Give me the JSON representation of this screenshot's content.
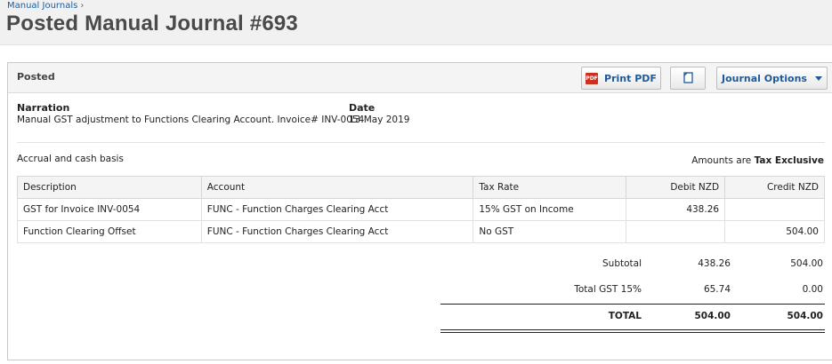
{
  "breadcrumb": {
    "parent": "Manual Journals",
    "separator": "›"
  },
  "page": {
    "title": "Posted Manual Journal #693"
  },
  "panel": {
    "status": "Posted",
    "buttons": {
      "print_pdf": "Print PDF",
      "copy_icon": "copy-icon",
      "journal_options": "Journal Options"
    }
  },
  "details": {
    "narration_label": "Narration",
    "narration_value": "Manual GST adjustment to Functions Clearing Account. Invoice# INV-0054",
    "date_label": "Date",
    "date_value": "13 May 2019"
  },
  "basis": "Accrual and cash basis",
  "amounts": {
    "prefix": "Amounts are",
    "mode": "Tax Exclusive"
  },
  "table": {
    "headers": [
      "Description",
      "Account",
      "Tax Rate",
      "Debit NZD",
      "Credit NZD"
    ],
    "rows": [
      {
        "description": "GST for Invoice INV-0054",
        "account": "FUNC - Function Charges Clearing Acct",
        "tax_rate": "15% GST on Income",
        "debit": "438.26",
        "credit": ""
      },
      {
        "description": "Function Clearing Offset",
        "account": "FUNC - Function Charges Clearing Acct",
        "tax_rate": "No GST",
        "debit": "",
        "credit": "504.00"
      }
    ]
  },
  "totals": {
    "subtotal": {
      "label": "Subtotal",
      "debit": "438.26",
      "credit": "504.00"
    },
    "gst": {
      "label": "Total GST 15%",
      "debit": "65.74",
      "credit": "0.00"
    },
    "total": {
      "label": "TOTAL",
      "debit": "504.00",
      "credit": "504.00"
    }
  },
  "colors": {
    "link": "#1a5e9c",
    "button_text": "#1f5a96",
    "pdf_icon": "#c8321f",
    "title": "#4a4a4a"
  }
}
